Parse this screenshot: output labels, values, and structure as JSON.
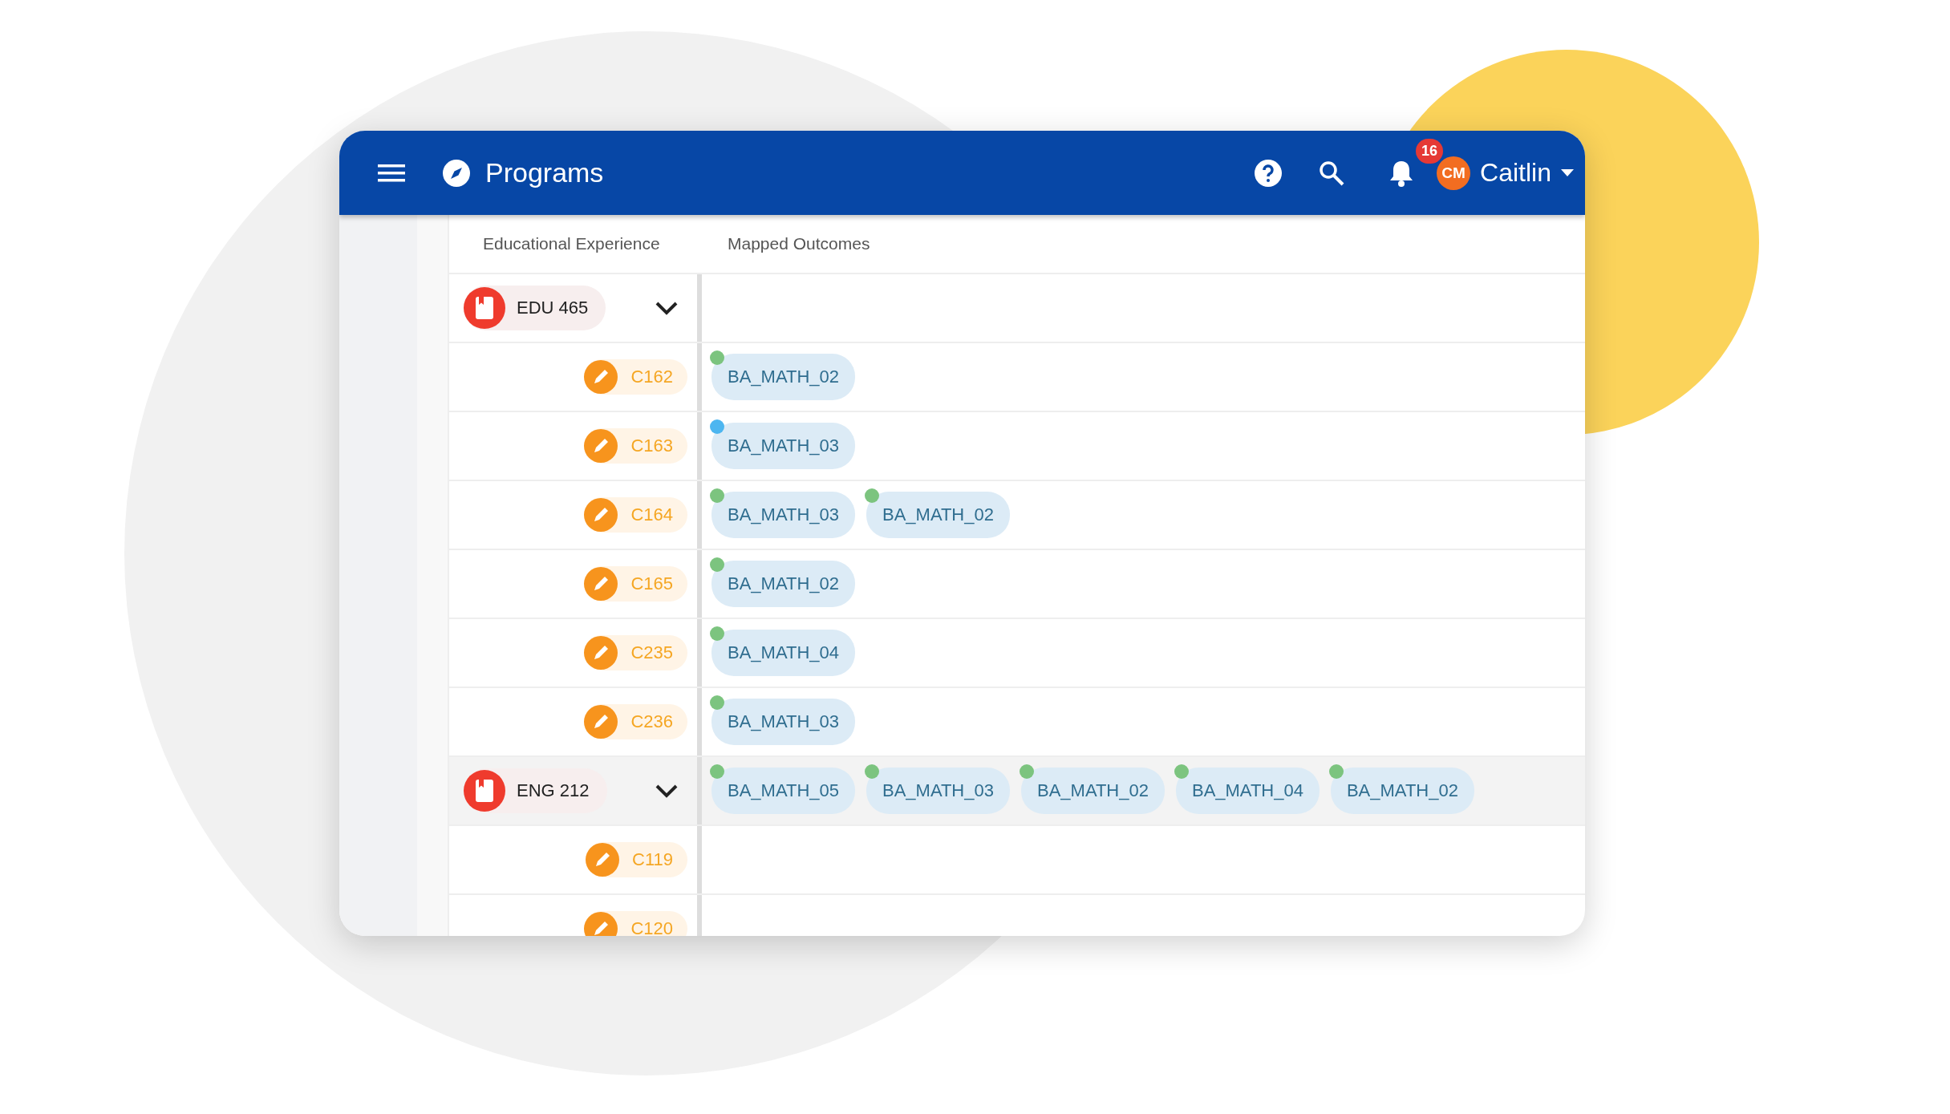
{
  "app_bar": {
    "title": "Programs",
    "notification_count": "16",
    "avatar_initials": "CM",
    "user_name": "Caitlin"
  },
  "table": {
    "columns": [
      "Educational Experience",
      "Mapped Outcomes"
    ],
    "groups": [
      {
        "course": "EDU 465",
        "expanded": true,
        "selected": false,
        "children": [
          {
            "code": "C162",
            "outcomes": [
              {
                "label": "BA_MATH_02",
                "color": "#7cc47f"
              }
            ]
          },
          {
            "code": "C163",
            "outcomes": [
              {
                "label": "BA_MATH_03",
                "color": "#4db6f0"
              }
            ]
          },
          {
            "code": "C164",
            "outcomes": [
              {
                "label": "BA_MATH_03",
                "color": "#7cc47f"
              },
              {
                "label": "BA_MATH_02",
                "color": "#7cc47f"
              }
            ]
          },
          {
            "code": "C165",
            "outcomes": [
              {
                "label": "BA_MATH_02",
                "color": "#7cc47f"
              }
            ]
          },
          {
            "code": "C235",
            "outcomes": [
              {
                "label": "BA_MATH_04",
                "color": "#7cc47f"
              }
            ]
          },
          {
            "code": "C236",
            "outcomes": [
              {
                "label": "BA_MATH_03",
                "color": "#7cc47f"
              }
            ]
          }
        ]
      },
      {
        "course": "ENG 212",
        "expanded": true,
        "selected": true,
        "outcomes": [
          {
            "label": "BA_MATH_05",
            "color": "#7cc47f"
          },
          {
            "label": "BA_MATH_03",
            "color": "#7cc47f"
          },
          {
            "label": "BA_MATH_02",
            "color": "#7cc47f"
          },
          {
            "label": "BA_MATH_04",
            "color": "#7cc47f"
          },
          {
            "label": "BA_MATH_02",
            "color": "#7cc47f"
          }
        ],
        "children": [
          {
            "code": "C119"
          },
          {
            "code": "C120"
          }
        ]
      }
    ]
  }
}
